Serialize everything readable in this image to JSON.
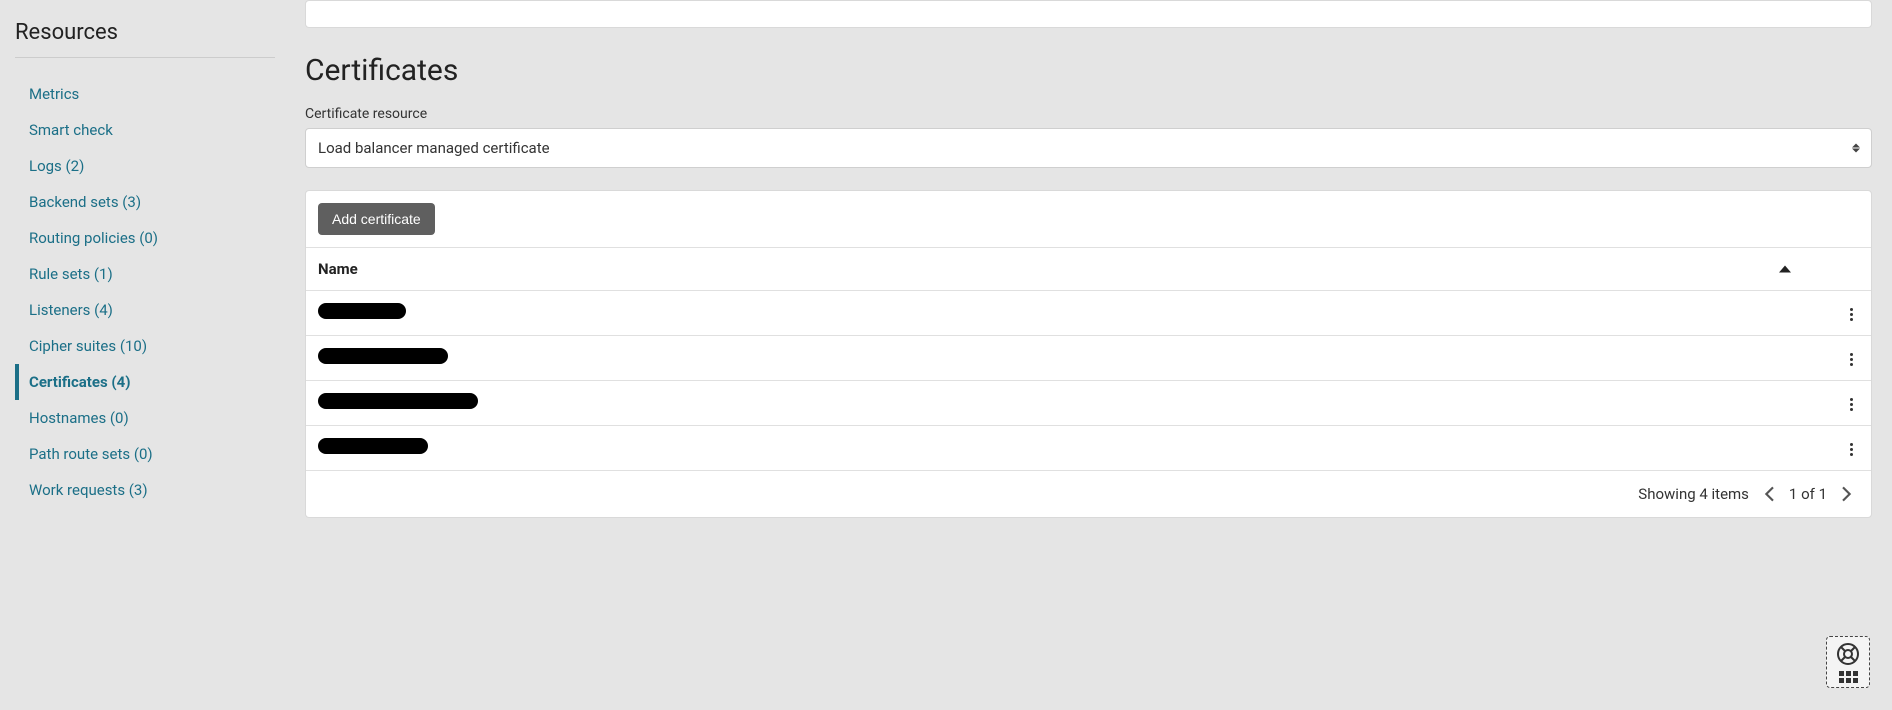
{
  "sidebar": {
    "title": "Resources",
    "items": [
      {
        "label": "Metrics",
        "active": false
      },
      {
        "label": "Smart check",
        "active": false
      },
      {
        "label": "Logs (2)",
        "active": false
      },
      {
        "label": "Backend sets (3)",
        "active": false
      },
      {
        "label": "Routing policies (0)",
        "active": false
      },
      {
        "label": "Rule sets (1)",
        "active": false
      },
      {
        "label": "Listeners (4)",
        "active": false
      },
      {
        "label": "Cipher suites (10)",
        "active": false
      },
      {
        "label": "Certificates (4)",
        "active": true
      },
      {
        "label": "Hostnames (0)",
        "active": false
      },
      {
        "label": "Path route sets (0)",
        "active": false
      },
      {
        "label": "Work requests (3)",
        "active": false
      }
    ]
  },
  "main": {
    "title": "Certificates",
    "resource_label": "Certificate resource",
    "resource_selected": "Load balancer managed certificate",
    "add_button": "Add certificate",
    "table": {
      "header_name": "Name",
      "rows": [
        {
          "redact_width": 88
        },
        {
          "redact_width": 130
        },
        {
          "redact_width": 160
        },
        {
          "redact_width": 110
        }
      ]
    },
    "pager": {
      "showing": "Showing 4 items",
      "position": "1 of 1"
    }
  }
}
